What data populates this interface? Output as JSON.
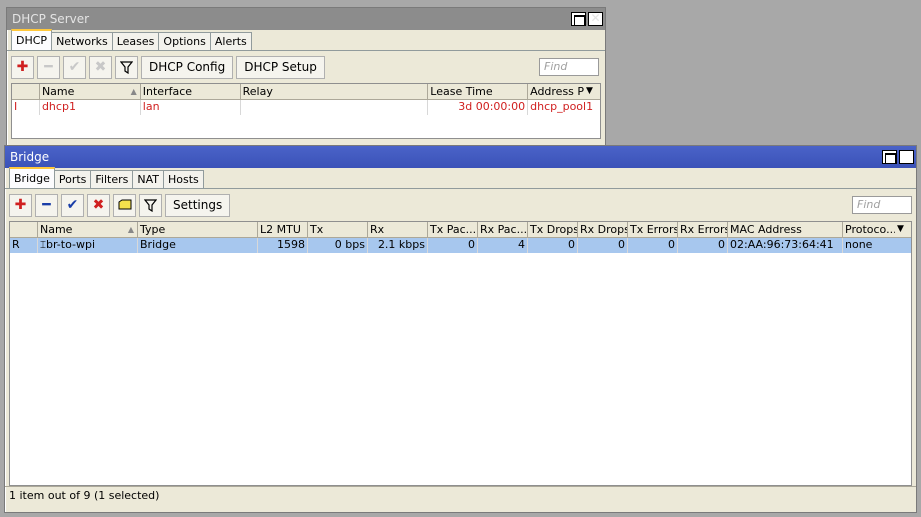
{
  "dhcp_window": {
    "title": "DHCP Server",
    "tabs": [
      "DHCP",
      "Networks",
      "Leases",
      "Options",
      "Alerts"
    ],
    "toolbar": {
      "config_label": "DHCP Config",
      "setup_label": "DHCP Setup",
      "find_placeholder": "Find"
    },
    "columns": [
      "Name",
      "Interface",
      "Relay",
      "Lease Time",
      "Address Po"
    ],
    "rows": [
      {
        "flag": "I",
        "name": "dhcp1",
        "interface": "lan",
        "relay": "",
        "lease_time": "3d 00:00:00",
        "address_pool": "dhcp_pool1"
      }
    ]
  },
  "bridge_window": {
    "title": "Bridge",
    "tabs": [
      "Bridge",
      "Ports",
      "Filters",
      "NAT",
      "Hosts"
    ],
    "toolbar": {
      "settings_label": "Settings",
      "find_placeholder": "Find"
    },
    "columns": [
      "Name",
      "Type",
      "L2 MTU",
      "Tx",
      "Rx",
      "Tx Pac...",
      "Rx Pac...",
      "Tx Drops",
      "Rx Drops",
      "Tx Errors",
      "Rx Errors",
      "MAC Address",
      "Protoco..."
    ],
    "rows": [
      {
        "flag": "R",
        "name": "br-to-wpi",
        "type": "Bridge",
        "l2mtu": "1598",
        "tx": "0 bps",
        "rx": "2.1 kbps",
        "tx_packets": "0",
        "rx_packets": "4",
        "tx_drops": "0",
        "rx_drops": "0",
        "tx_errors": "0",
        "rx_errors": "0",
        "mac": "02:AA:96:73:64:41",
        "protocol": "none"
      }
    ],
    "status": "1 item out of 9 (1 selected)"
  },
  "colors": {
    "disabled_row": "#d02020",
    "selected_row": "#a7c7ee",
    "active_title": "#3b52b8",
    "inactive_title": "#8c8c8c"
  }
}
